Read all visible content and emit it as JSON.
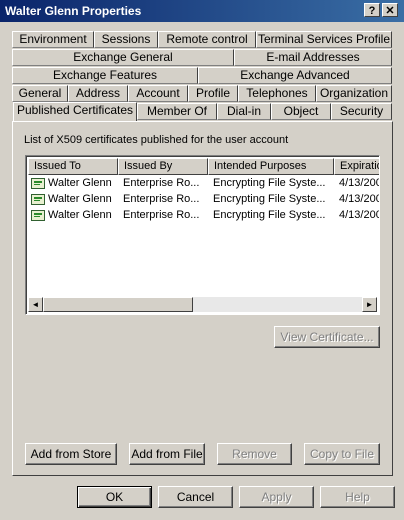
{
  "window": {
    "title": "Walter Glenn Properties",
    "help_glyph": "?",
    "close_glyph": "✕"
  },
  "tabs": {
    "row1": [
      "Environment",
      "Sessions",
      "Remote control",
      "Terminal Services Profile"
    ],
    "row2": [
      "Exchange General",
      "E-mail Addresses"
    ],
    "row3": [
      "Exchange Features",
      "Exchange Advanced"
    ],
    "row4": [
      "General",
      "Address",
      "Account",
      "Profile",
      "Telephones",
      "Organization"
    ],
    "row5": [
      "Published Certificates",
      "Member Of",
      "Dial-in",
      "Object",
      "Security"
    ],
    "active": "Published Certificates"
  },
  "panel": {
    "description": "List of X509 certificates published for the user account",
    "columns": [
      "Issued To",
      "Issued By",
      "Intended Purposes",
      "Expiration"
    ],
    "rows": [
      [
        "Walter Glenn",
        "Enterprise Ro...",
        "Encrypting File Syste...",
        "4/13/200"
      ],
      [
        "Walter Glenn",
        "Enterprise Ro...",
        "Encrypting File Syste...",
        "4/13/200"
      ],
      [
        "Walter Glenn",
        "Enterprise Ro...",
        "Encrypting File Syste...",
        "4/13/200"
      ]
    ],
    "scroll_left": "◄",
    "scroll_right": "►",
    "view_certificate": "View Certificate...",
    "add_from_store": "Add from Store",
    "add_from_file": "Add from File",
    "remove": "Remove",
    "copy_to_file": "Copy to File"
  },
  "footer": {
    "ok": "OK",
    "cancel": "Cancel",
    "apply": "Apply",
    "help": "Help"
  }
}
